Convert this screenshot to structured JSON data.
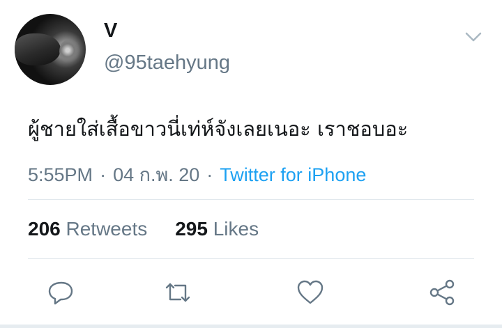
{
  "user": {
    "name": "V",
    "handle": "@95taehyung"
  },
  "tweet": {
    "text": "ผู้ชายใส่เสื้อขาวนี่เท่ห์จังเลยเนอะ เราชอบอะ",
    "time": "5:55PM",
    "date": "04 ก.พ. 20",
    "source": "Twitter for iPhone",
    "separator": "·"
  },
  "stats": {
    "retweets_count": "206",
    "retweets_label": "Retweets",
    "likes_count": "295",
    "likes_label": "Likes"
  },
  "icons": {
    "menu": "chevron-down-icon",
    "reply": "reply-icon",
    "retweet": "retweet-icon",
    "like": "heart-icon",
    "share": "share-icon"
  },
  "colors": {
    "text": "#14171a",
    "secondary": "#657786",
    "link": "#1da1f2",
    "divider": "#e1e8ed"
  }
}
